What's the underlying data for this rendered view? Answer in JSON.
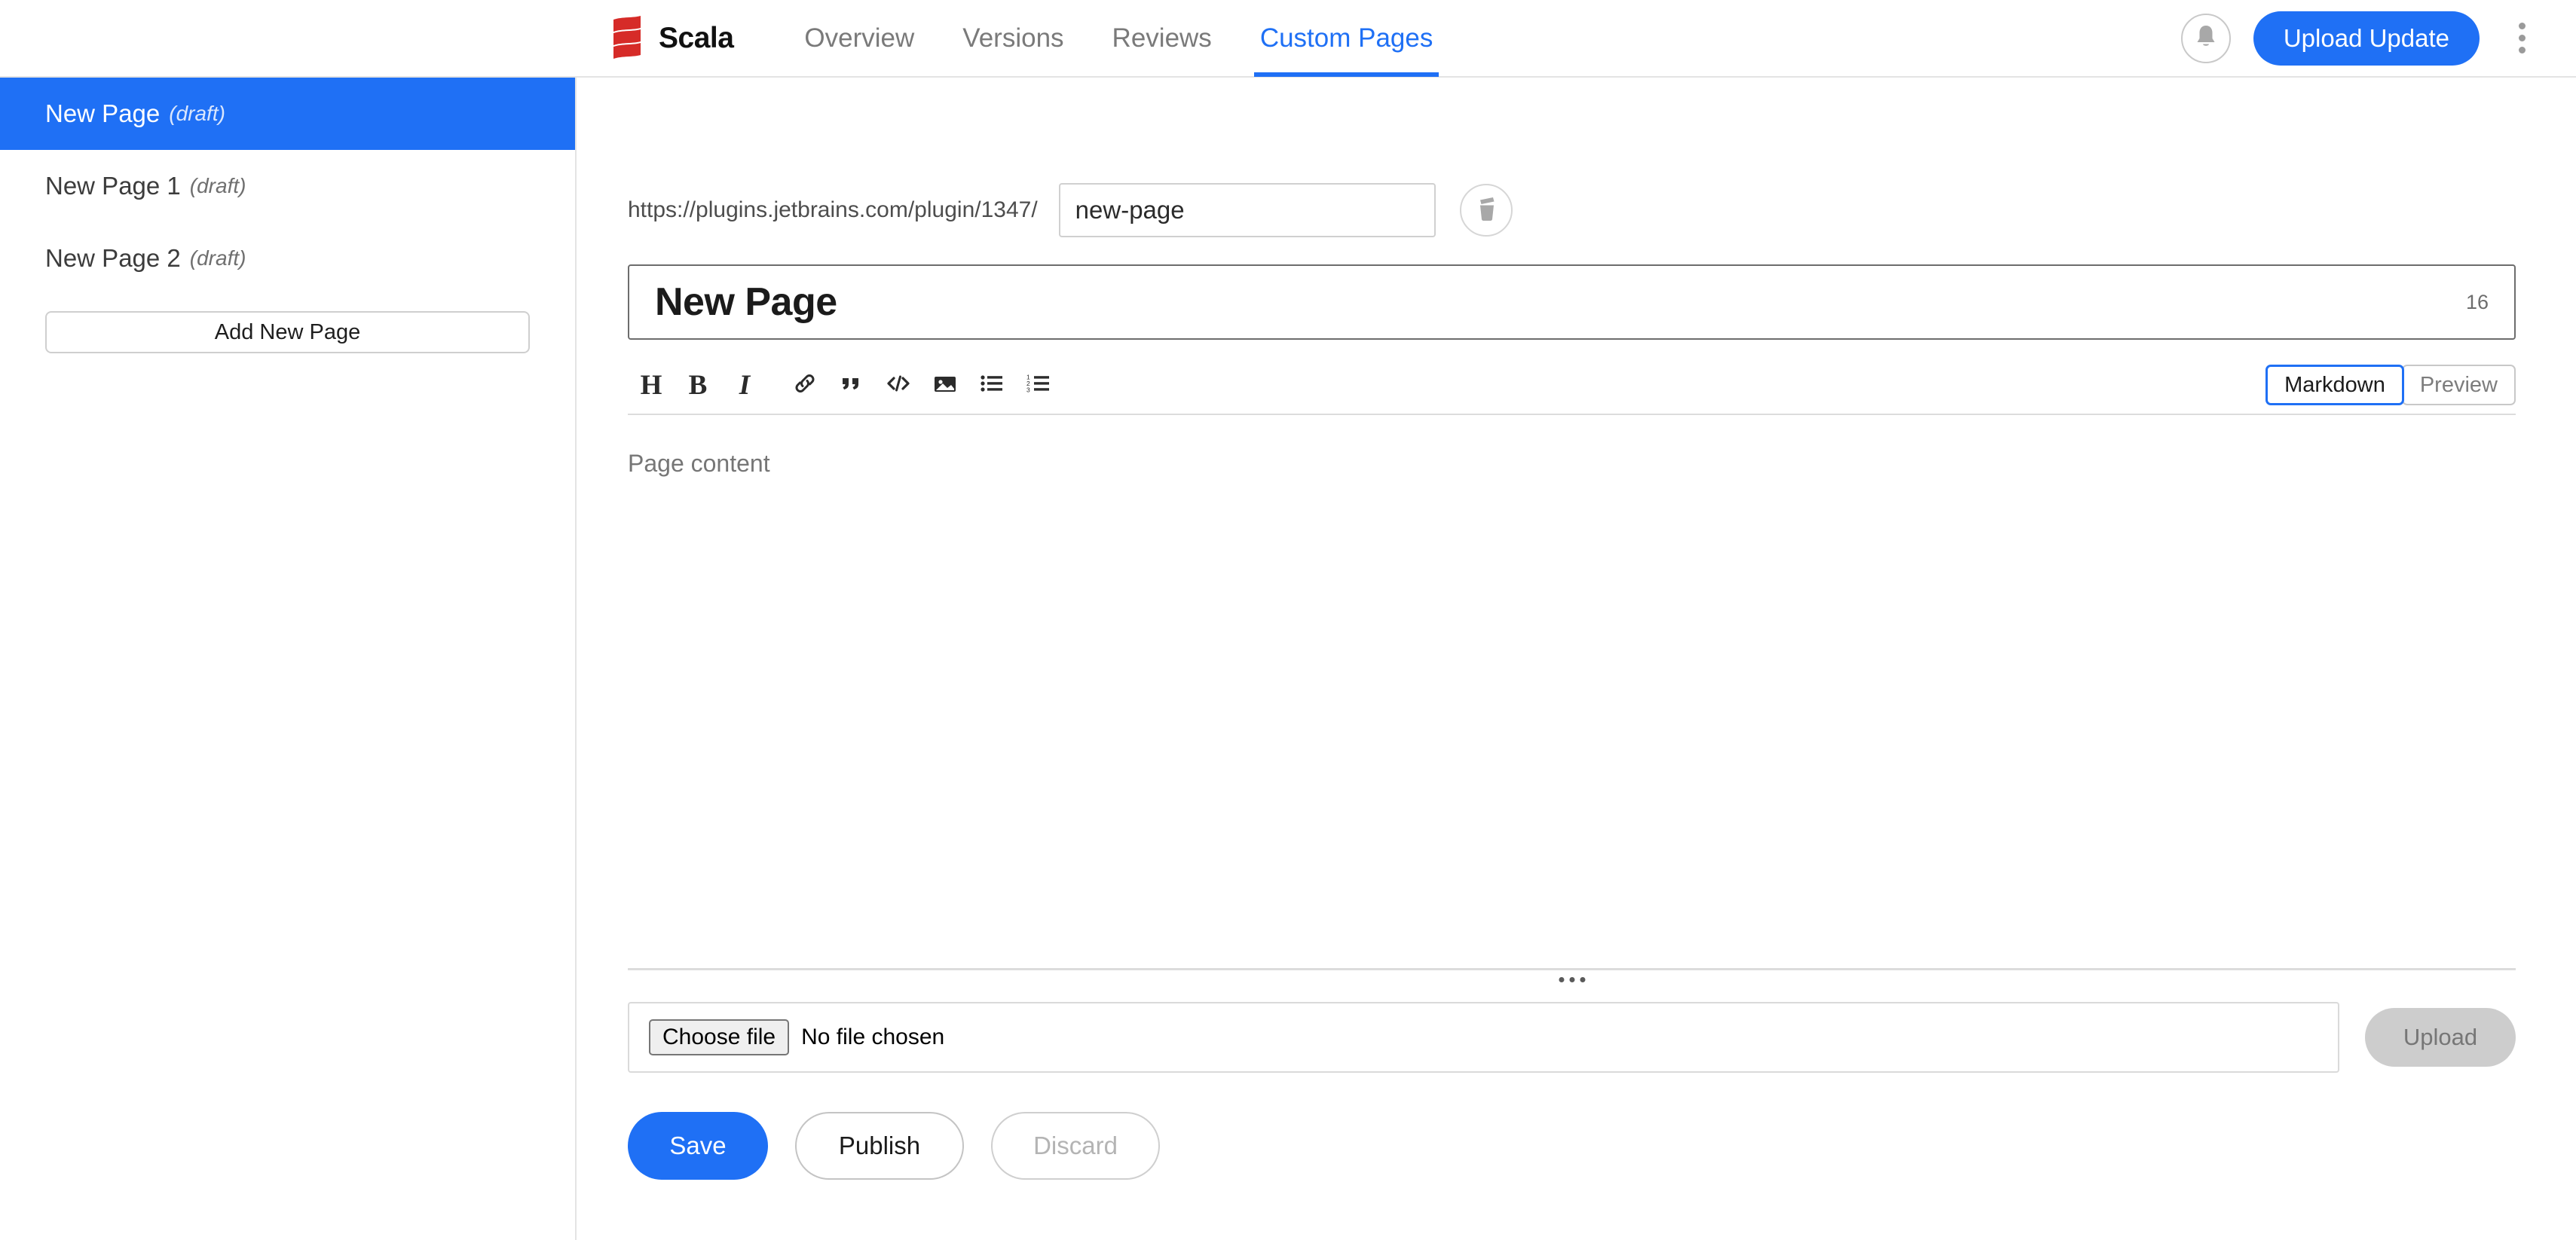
{
  "header": {
    "brand_name": "Scala",
    "logo_icon": "scala-logo",
    "nav": [
      {
        "label": "Overview",
        "active": false
      },
      {
        "label": "Versions",
        "active": false
      },
      {
        "label": "Reviews",
        "active": false
      },
      {
        "label": "Custom Pages",
        "active": true
      }
    ],
    "notifications_icon": "bell-icon",
    "upload_update_label": "Upload Update",
    "overflow_icon": "kebab-menu-icon"
  },
  "sidebar": {
    "items": [
      {
        "label": "New Page",
        "status": "(draft)",
        "selected": true
      },
      {
        "label": "New Page 1",
        "status": "(draft)",
        "selected": false
      },
      {
        "label": "New Page 2",
        "status": "(draft)",
        "selected": false
      }
    ],
    "add_page_label": "Add New Page"
  },
  "page_settings": {
    "url_prefix": "https://plugins.jetbrains.com/plugin/1347/",
    "slug_value": "new-page",
    "delete_icon": "trash-icon"
  },
  "title_field": {
    "value": "New Page",
    "char_count": "16"
  },
  "toolbar": {
    "tools": [
      {
        "name": "heading-icon",
        "glyph": "H"
      },
      {
        "name": "bold-icon",
        "glyph": "B"
      },
      {
        "name": "italic-icon",
        "glyph": "I"
      },
      {
        "name": "link-icon",
        "glyph": ""
      },
      {
        "name": "quote-icon",
        "glyph": ""
      },
      {
        "name": "code-icon",
        "glyph": ""
      },
      {
        "name": "image-icon",
        "glyph": ""
      },
      {
        "name": "bullet-list-icon",
        "glyph": ""
      },
      {
        "name": "numbered-list-icon",
        "glyph": ""
      }
    ],
    "markdown_label": "Markdown",
    "preview_label": "Preview",
    "active_mode": "Markdown"
  },
  "editor": {
    "placeholder": "Page content",
    "content": ""
  },
  "file_upload": {
    "choose_file_label": "Choose file",
    "no_file_label": "No file chosen",
    "upload_label": "Upload"
  },
  "actions": {
    "save_label": "Save",
    "publish_label": "Publish",
    "discard_label": "Discard"
  },
  "colors": {
    "accent_blue": "#1f70f5",
    "logo_red": "#d62b28",
    "disabled_gray": "#cdcdcd"
  }
}
